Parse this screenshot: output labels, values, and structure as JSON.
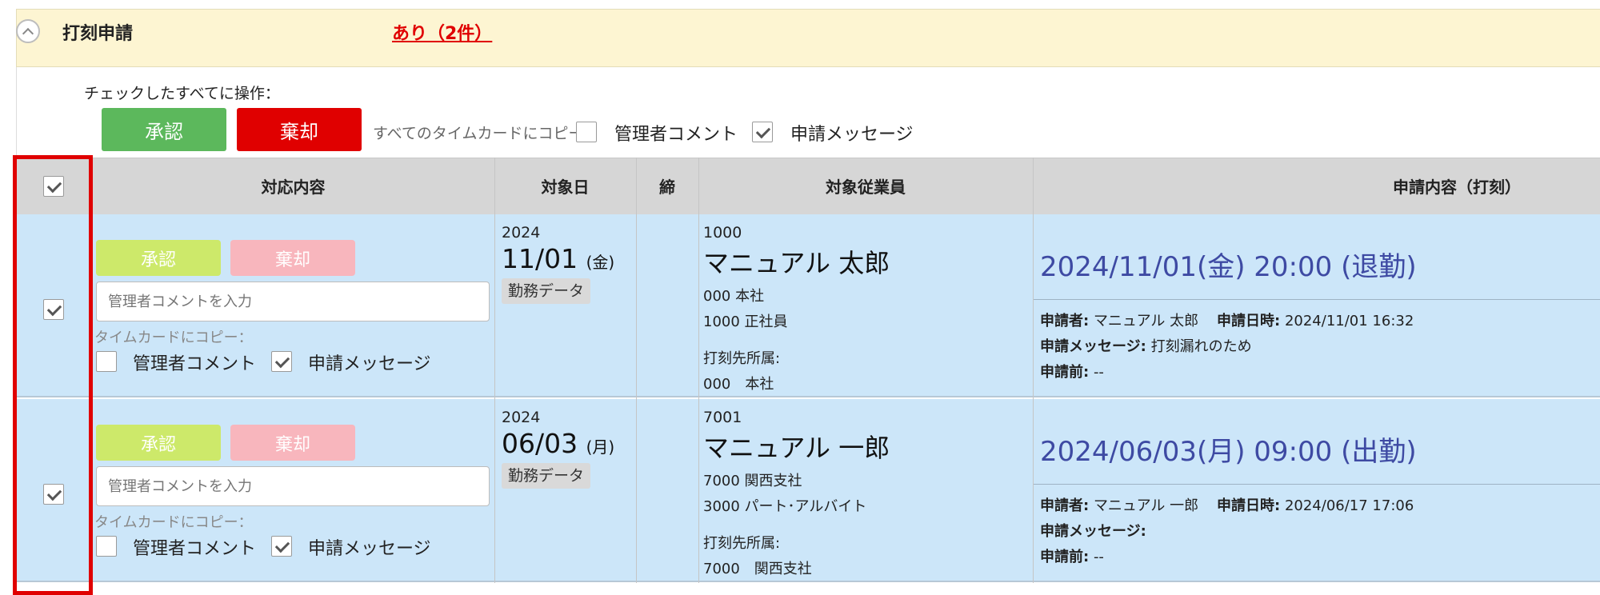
{
  "section": {
    "title": "打刻申請",
    "status": "あり（2件）"
  },
  "bulk": {
    "label": "チェックしたすべてに操作：",
    "approve": "承認",
    "reject": "棄却",
    "copy_all_label": "すべてのタイムカードにコピー：",
    "option_admin_comment": "管理者コメント",
    "option_request_message": "申請メッセージ"
  },
  "table": {
    "headers": {
      "action": "対応内容",
      "date": "対象日",
      "lock": "締",
      "employee": "対象従業員",
      "request": "申請内容（打刻）"
    }
  },
  "rows": [
    {
      "approve": "承認",
      "reject": "棄却",
      "comment_placeholder": "管理者コメントを入力",
      "copy_label": "タイムカードにコピー：",
      "opt_admin_comment": "管理者コメント",
      "opt_request_message": "申請メッセージ",
      "year": "2024",
      "date": "11/01",
      "weekday": "(金)",
      "tag": "勤務データ",
      "emp_code": "1000",
      "emp_name": "マニュアル 太郎",
      "emp_dept": "000 本社",
      "emp_type": "1000 正社員",
      "clock_affil_label": "打刻先所属:",
      "clock_affil": "000　本社",
      "request_main": "2024/11/01(金) 20:00 (退勤)",
      "applicant_label": "申請者:",
      "applicant": "マニュアル 太郎",
      "applied_at_label": "申請日時:",
      "applied_at": "2024/11/01 16:32",
      "message_label": "申請メッセージ:",
      "message": "打刻漏れのため",
      "before_label": "申請前:",
      "before": "--"
    },
    {
      "approve": "承認",
      "reject": "棄却",
      "comment_placeholder": "管理者コメントを入力",
      "copy_label": "タイムカードにコピー：",
      "opt_admin_comment": "管理者コメント",
      "opt_request_message": "申請メッセージ",
      "year": "2024",
      "date": "06/03",
      "weekday": "(月)",
      "tag": "勤務データ",
      "emp_code": "7001",
      "emp_name": "マニュアル 一郎",
      "emp_dept": "7000 関西支社",
      "emp_type": "3000 パート･アルバイト",
      "clock_affil_label": "打刻先所属:",
      "clock_affil": "7000　関西支社",
      "request_main": "2024/06/03(月) 09:00 (出勤)",
      "applicant_label": "申請者:",
      "applicant": "マニュアル 一郎",
      "applied_at_label": "申請日時:",
      "applied_at": "2024/06/17 17:06",
      "message_label": "申請メッセージ:",
      "message": "",
      "before_label": "申請前:",
      "before": "--"
    }
  ],
  "colors": {
    "approve": "#5cb85c",
    "reject": "#e00000",
    "row_bg": "#cce6f9",
    "header_bg": "#fdf5d2",
    "request_text": "#3e4aa3"
  }
}
